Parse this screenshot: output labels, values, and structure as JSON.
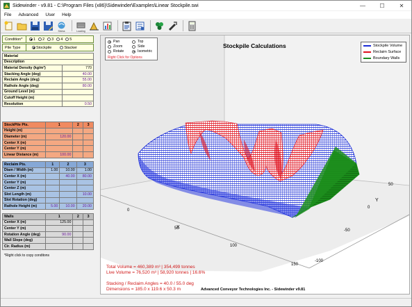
{
  "window": {
    "title": "Sidewinder - v9.81 - C:\\Program Files (x86)\\Sidewinder\\Examples\\Linear Stockpile.swi",
    "minimize": "—",
    "maximize": "☐",
    "close": "✕"
  },
  "menu": [
    "File",
    "Advanced",
    "User",
    "Help"
  ],
  "toolbar": {
    "loading_caption": "Loading",
    "stress_caption": "Stress"
  },
  "condition": {
    "label": "Condition",
    "options": [
      "1",
      "2",
      "3",
      "4",
      "5"
    ],
    "selected": "1"
  },
  "pile_type": {
    "label": "Pile Type",
    "options": [
      "Stockpile",
      "Stacker"
    ],
    "selected": "Stockpile"
  },
  "material": {
    "rows": [
      {
        "label": "Material",
        "value": ""
      },
      {
        "label": "Description",
        "value": ""
      },
      {
        "label": "Material Density (kg/m³)",
        "value": "770"
      },
      {
        "label": "Stacking Angle (deg)",
        "value": "40.00"
      },
      {
        "label": "Reclaim Angle (deg)",
        "value": "55.00"
      },
      {
        "label": "Rathole Angle (deg)",
        "value": "80.00"
      },
      {
        "label": "Ground Level (m)",
        "value": ""
      },
      {
        "label": "Cutoff Height (m)",
        "value": ""
      },
      {
        "label": "Resolution",
        "value": "0.50"
      }
    ]
  },
  "stockpile_pts": {
    "header": [
      "StockPile Pts.",
      "1",
      "2",
      "3"
    ],
    "rows": [
      {
        "label": "Height (m)",
        "v1": "",
        "v2": "",
        "v3": ""
      },
      {
        "label": "Diameter (m)",
        "v1": "120.00",
        "v2": "",
        "v3": ""
      },
      {
        "label": "Center X (m)",
        "v1": "",
        "v2": "",
        "v3": ""
      },
      {
        "label": "Center Y (m)",
        "v1": "",
        "v2": "",
        "v3": ""
      },
      {
        "label": "Linear Distance (m)",
        "v1": "100.00",
        "v2": "",
        "v3": ""
      }
    ]
  },
  "reclaim_pts": {
    "header": [
      "Reclaim Pts.",
      "1",
      "2",
      "3"
    ],
    "rows": [
      {
        "label": "Diam / Width (m)",
        "v1": "1.00",
        "v2": "10.00",
        "v3": "1.00"
      },
      {
        "label": "Center X (m)",
        "v1": "",
        "v2": "40.00",
        "v3": "80.00"
      },
      {
        "label": "Center Y (m)",
        "v1": "",
        "v2": "",
        "v3": ""
      },
      {
        "label": "Center Z (m)",
        "v1": "",
        "v2": "",
        "v3": ""
      },
      {
        "label": "Slot Length (m)",
        "v1": "",
        "v2": "",
        "v3": "10.00"
      },
      {
        "label": "Slot Rotation (deg)",
        "v1": "",
        "v2": "",
        "v3": ""
      },
      {
        "label": "Rathole Height (m)",
        "v1": "5.00",
        "v2": "10.00",
        "v3": "20.00"
      }
    ]
  },
  "walls": {
    "header": [
      "Walls",
      "1",
      "2",
      "3"
    ],
    "rows": [
      {
        "label": "Center X (m)",
        "v1": "125.00",
        "v2": "",
        "v3": ""
      },
      {
        "label": "Center Y (m)",
        "v1": "",
        "v2": "",
        "v3": ""
      },
      {
        "label": "Rotation Angle (deg)",
        "v1": "90.00",
        "v2": "",
        "v3": ""
      },
      {
        "label": "Wall Slope (deg)",
        "v1": "",
        "v2": "",
        "v3": ""
      },
      {
        "label": "Cir. Radius (m)",
        "v1": "",
        "v2": "",
        "v3": ""
      }
    ]
  },
  "footnote": "*Right click to copy conditons",
  "view_options": {
    "options": [
      "Pan",
      "Zoom",
      "Rotate",
      "Top",
      "Side",
      "Isometric"
    ],
    "selected": [
      "Pan",
      "Isometric"
    ],
    "hint": "Right Click for Options"
  },
  "plot": {
    "title": "Stockpile Calculations",
    "legend": [
      {
        "name": "Stockpile Volume",
        "color": "#1a2cd6"
      },
      {
        "name": "Reclaim Surface",
        "color": "#e0101e"
      },
      {
        "name": "Boundary Walls",
        "color": "#1a8a1a"
      }
    ],
    "x_axis": {
      "label": "X",
      "ticks": [
        "0",
        "50",
        "100",
        "150"
      ]
    },
    "y_axis": {
      "label": "Y",
      "ticks": [
        "50",
        "0",
        "-50",
        "-100"
      ]
    },
    "stats": [
      "Total Volume = 460,389 m³ | 354,499 tonnes",
      "Live Volume = 76,520 m³ | 58,920 tonnes | 16.6%",
      "",
      "Stacking / Reclaim Angles = 40.0 / 55.0 deg",
      "Dimensions = 185.0 x 119.6 x 50.3 m"
    ],
    "credit": "Advanced Conveyor Technologies Inc. - Sidewinder  v9.81"
  },
  "colors": {
    "material_bg": "#ffffe0",
    "stockpile_bg": "#f4a882",
    "reclaim_bg": "#a9c3e4",
    "walls_bg": "#d9d9d9",
    "mesh_blue": "#1a2cd6",
    "mesh_red": "#e0101e",
    "mesh_green": "#1a8a1a"
  }
}
